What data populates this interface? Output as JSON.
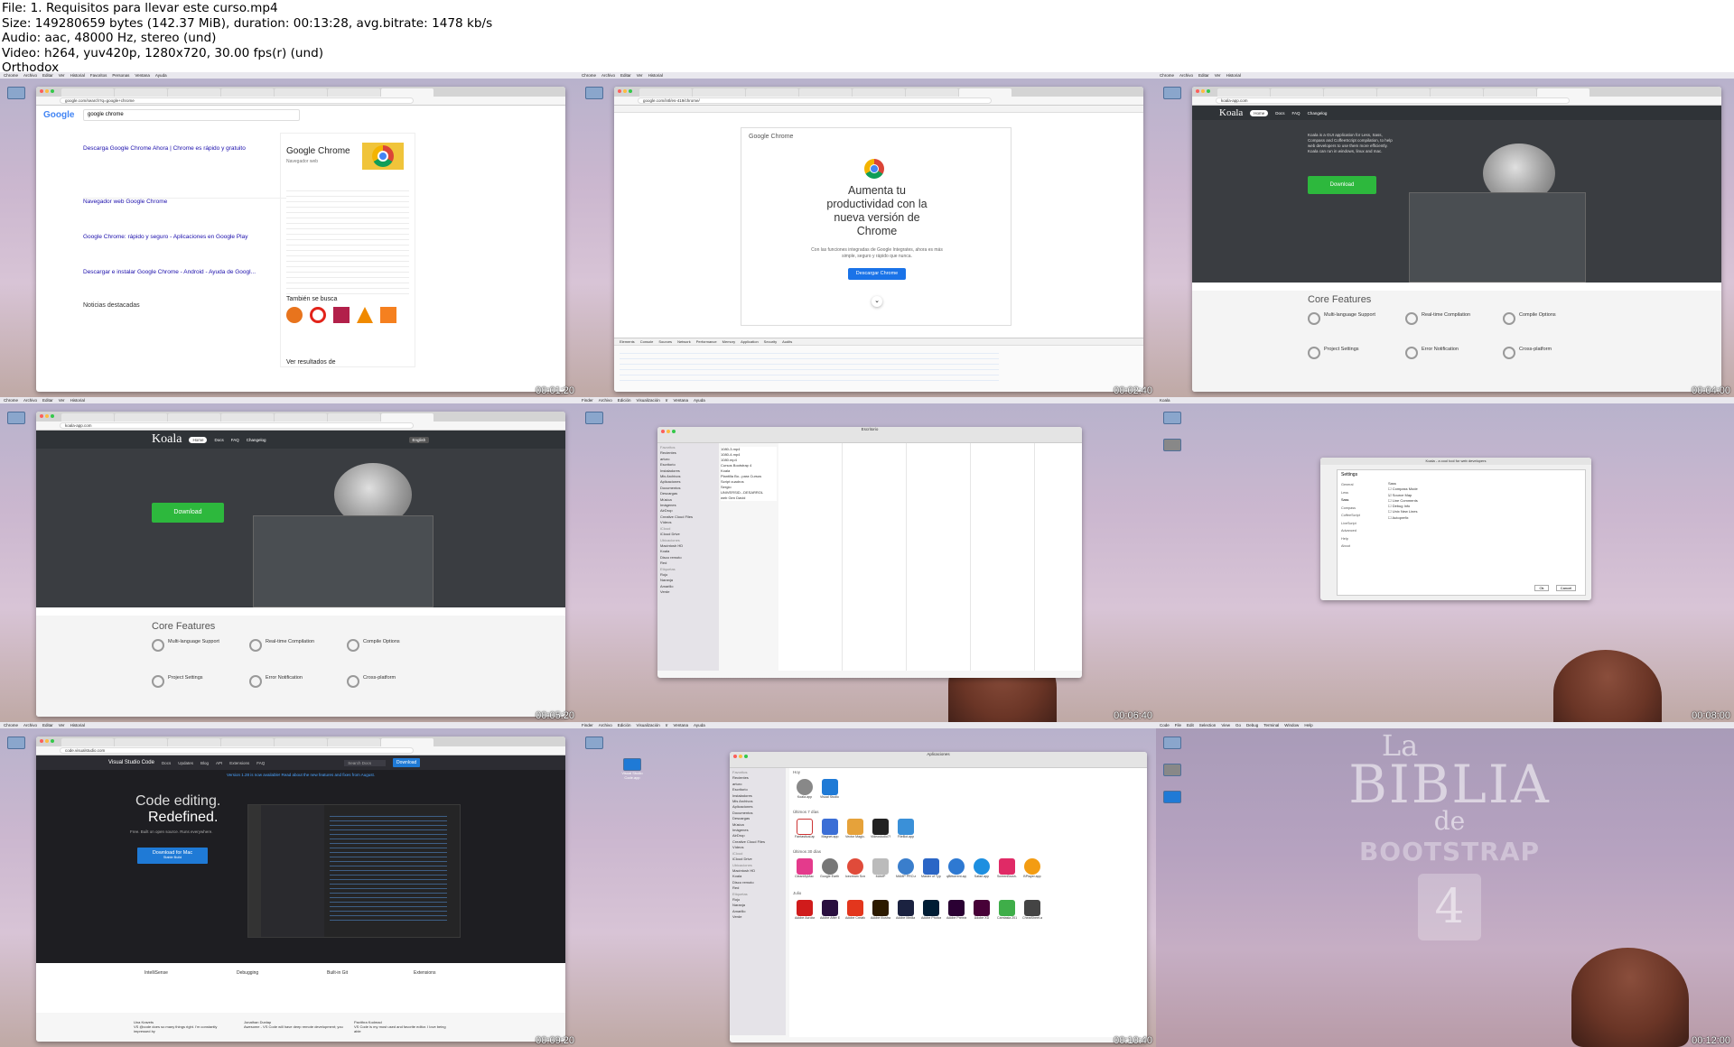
{
  "header": {
    "file_line": "File: 1. Requisitos para llevar este curso.mp4",
    "size_line": "Size: 149280659 bytes (142.37 MiB), duration: 00:13:28, avg.bitrate: 1478 kb/s",
    "audio_line": "Audio: aac, 48000 Hz, stereo (und)",
    "video_line": "Video: h264, yuv420p, 1280x720, 30.00 fps(r) (und)",
    "author_line": "Orthodox"
  },
  "thumbs": [
    {
      "timestamp": "00:01:20",
      "app": "Chrome",
      "url": "google.com/search?q=google+chrome",
      "search_query": "google chrome",
      "result_titles": [
        "Descarga Google Chrome Ahora | Chrome es rápido y gratuito",
        "Navegador web Google Chrome",
        "Google Chrome: rápido y seguro - Aplicaciones en Google Play",
        "Descargar e instalar Google Chrome - Android - Ayuda de Googl..."
      ],
      "knowledge_title": "Google Chrome",
      "knowledge_sub": "Navegador web",
      "also_search": "También se busca",
      "news": "Noticias destacadas",
      "see_results": "Ver resultados de"
    },
    {
      "timestamp": "00:02:40",
      "app": "Chrome",
      "url": "google.com/intl/es-419/chrome/",
      "brand": "Google Chrome",
      "headline": "Aumenta tu productividad con la nueva versión de Chrome",
      "subline": "Con las funciones integradas de Google Integrates, ahora es más simple, seguro y rápido que nunca.",
      "cta": "Descargar Chrome",
      "devtools_tabs": [
        "Elements",
        "Console",
        "Sources",
        "Network",
        "Performance",
        "Memory",
        "Application",
        "Security",
        "Audits"
      ]
    },
    {
      "timestamp": "00:04:00",
      "app": "Chrome",
      "url": "koala-app.com",
      "brand": "Koala",
      "nav": [
        "Home",
        "Docs",
        "FAQ",
        "Changelog"
      ],
      "desc": "Koala is a GUI application for Less, Sass, Compass and CoffeeScript compilation, to help web developers to use them more efficiently. Koala can run in windows, linux and mac.",
      "download": "Download",
      "core_heading": "Core Features",
      "features": [
        "Multi-language Support",
        "Real-time Compilation",
        "Compile Options",
        "Project Settings",
        "Error Notification",
        "Cross-platform"
      ]
    },
    {
      "timestamp": "00:05:20",
      "app": "Chrome",
      "url": "koala-app.com",
      "brand": "Koala",
      "nav": [
        "Home",
        "Docs",
        "FAQ",
        "Changelog"
      ],
      "lang": "English",
      "download": "Download",
      "core_heading": "Core Features",
      "features": [
        "Multi-language Support",
        "Real-time Compilation",
        "Compile Options",
        "Project Settings",
        "Error Notification",
        "Cross-platform"
      ]
    },
    {
      "timestamp": "00:06:40",
      "app": "Finder",
      "window_title": "Escritorio",
      "sidebar": [
        "Favoritos",
        "Recientes",
        "arturo",
        "Escritorio",
        "Instaladores",
        "Mis Archivos",
        "Aplicaciones",
        "Documentos",
        "Descargas",
        "Música",
        "Imágenes",
        "AirDrop",
        "Creative Cloud Files",
        "Vídeos",
        "iCloud",
        "iCloud Drive",
        "Ubicaciones",
        "Macintosh HD",
        "Koala",
        "Disco remoto",
        "Red",
        "Etiquetas",
        "Rojo",
        "Naranja",
        "Amarillo",
        "Verde"
      ],
      "files": [
        "1080-3.mp4",
        "1080-4.mp4",
        "1080.mp4",
        "Cursos Bootstrap 4",
        "Koala",
        "Plantilla Bo...para Cursos",
        "Script cuadros",
        "Sergio",
        "UNIVERSID...DESARROL",
        "web Gen David"
      ]
    },
    {
      "timestamp": "00:08:00",
      "app": "Koala",
      "window_title": "Koala - a cool tool for web developers",
      "dialog_title": "Settings",
      "sections": [
        "General",
        "Less",
        "Sass",
        "Compass",
        "CoffeeScript",
        "LiveScript",
        "Advanced",
        "Help",
        "About"
      ],
      "dialog_heading": "Sass",
      "options": [
        "Compass Mode",
        "Source Map",
        "Line Comments",
        "Debug Info",
        "Unix New Lines",
        "Autoprefix"
      ],
      "ok": "Ok",
      "cancel": "Cancel"
    },
    {
      "timestamp": "00:09:20",
      "app": "Chrome",
      "url": "code.visualstudio.com",
      "brand": "Visual Studio Code",
      "nav": [
        "Docs",
        "Updates",
        "Blog",
        "API",
        "Extensions",
        "FAQ"
      ],
      "announce": "Version 1.28 is now available! Read about the new features and fixes from August.",
      "hero_line1": "Code editing.",
      "hero_line2": "Redefined.",
      "hero_sub": "Free. Built on open source. Runs everywhere.",
      "download_btn": "Download for Mac",
      "download_sub": "Stable Build",
      "search": "Search Docs",
      "top_download": "Download",
      "features": [
        "IntelliSense",
        "Debugging",
        "Built-in Git",
        "Extensions"
      ],
      "tweets": [
        {
          "name": "Una Kravets",
          "text": "VS @code does so many things right. I'm constantly impressed by"
        },
        {
          "name": "Jonathan Dunlap",
          "text": "Awesome - VS Code will have deep remote development; you"
        },
        {
          "name": "Pavithra Kodmad",
          "text": "VS Code is my most used and favorite editor. I love being able"
        }
      ]
    },
    {
      "timestamp": "00:10:40",
      "app": "Finder",
      "window_title": "Aplicaciones",
      "desktop_icon": "Visual Studio Code.app",
      "groups": [
        "Hoy",
        "Últimos 7 días",
        "Últimos 30 días",
        "Julio"
      ],
      "today_apps": [
        "Koala.app",
        "Visual Studio Code.app"
      ],
      "week_apps": [
        "Fantastical.app",
        "Magnet.app",
        "Vector Magic.app",
        "Videostudio7S.app",
        "FileBot.app"
      ],
      "month_apps": [
        "CleanMyMac X.app",
        "Google Earth Pro.app",
        "Icecream Screen Recorder.app",
        "MAMP",
        "MAMP PRO.app",
        "Master of Typing in Spanish.app",
        "qBittorrent.app",
        "Safari.app",
        "ScreenBrush.app",
        "BPlayer.app"
      ],
      "july_apps": [
        "Adobe Acrobat Reader DC.app",
        "Adobe After Effects CC 2019",
        "Adobe Creative Cloud",
        "Adobe Illustrator CC 2019",
        "Adobe Media Encoder CC 2019",
        "Adobe Photoshop CC 2019",
        "Adobe Premiere Pro CC 2019",
        "Adobe XD",
        "Camtasia 2018.app",
        "CheatSheet.app"
      ]
    },
    {
      "timestamp": "00:12:00",
      "app": "Code",
      "menu": [
        "Code",
        "File",
        "Edit",
        "Selection",
        "View",
        "Go",
        "Debug",
        "Terminal",
        "Window",
        "Help"
      ],
      "wall_line1": "La",
      "wall_line2": "BIBLIA",
      "wall_line3": "de",
      "wall_line4": "BOOTSTRAP",
      "wall_line5": "4"
    }
  ],
  "mac_menu": [
    "Archivo",
    "Editar",
    "Ver",
    "Historial",
    "Favoritos",
    "Personas",
    "Ventana",
    "Ayuda"
  ],
  "finder_menu": [
    "Archivo",
    "Edición",
    "Visualización",
    "Ir",
    "Ventana",
    "Ayuda"
  ]
}
